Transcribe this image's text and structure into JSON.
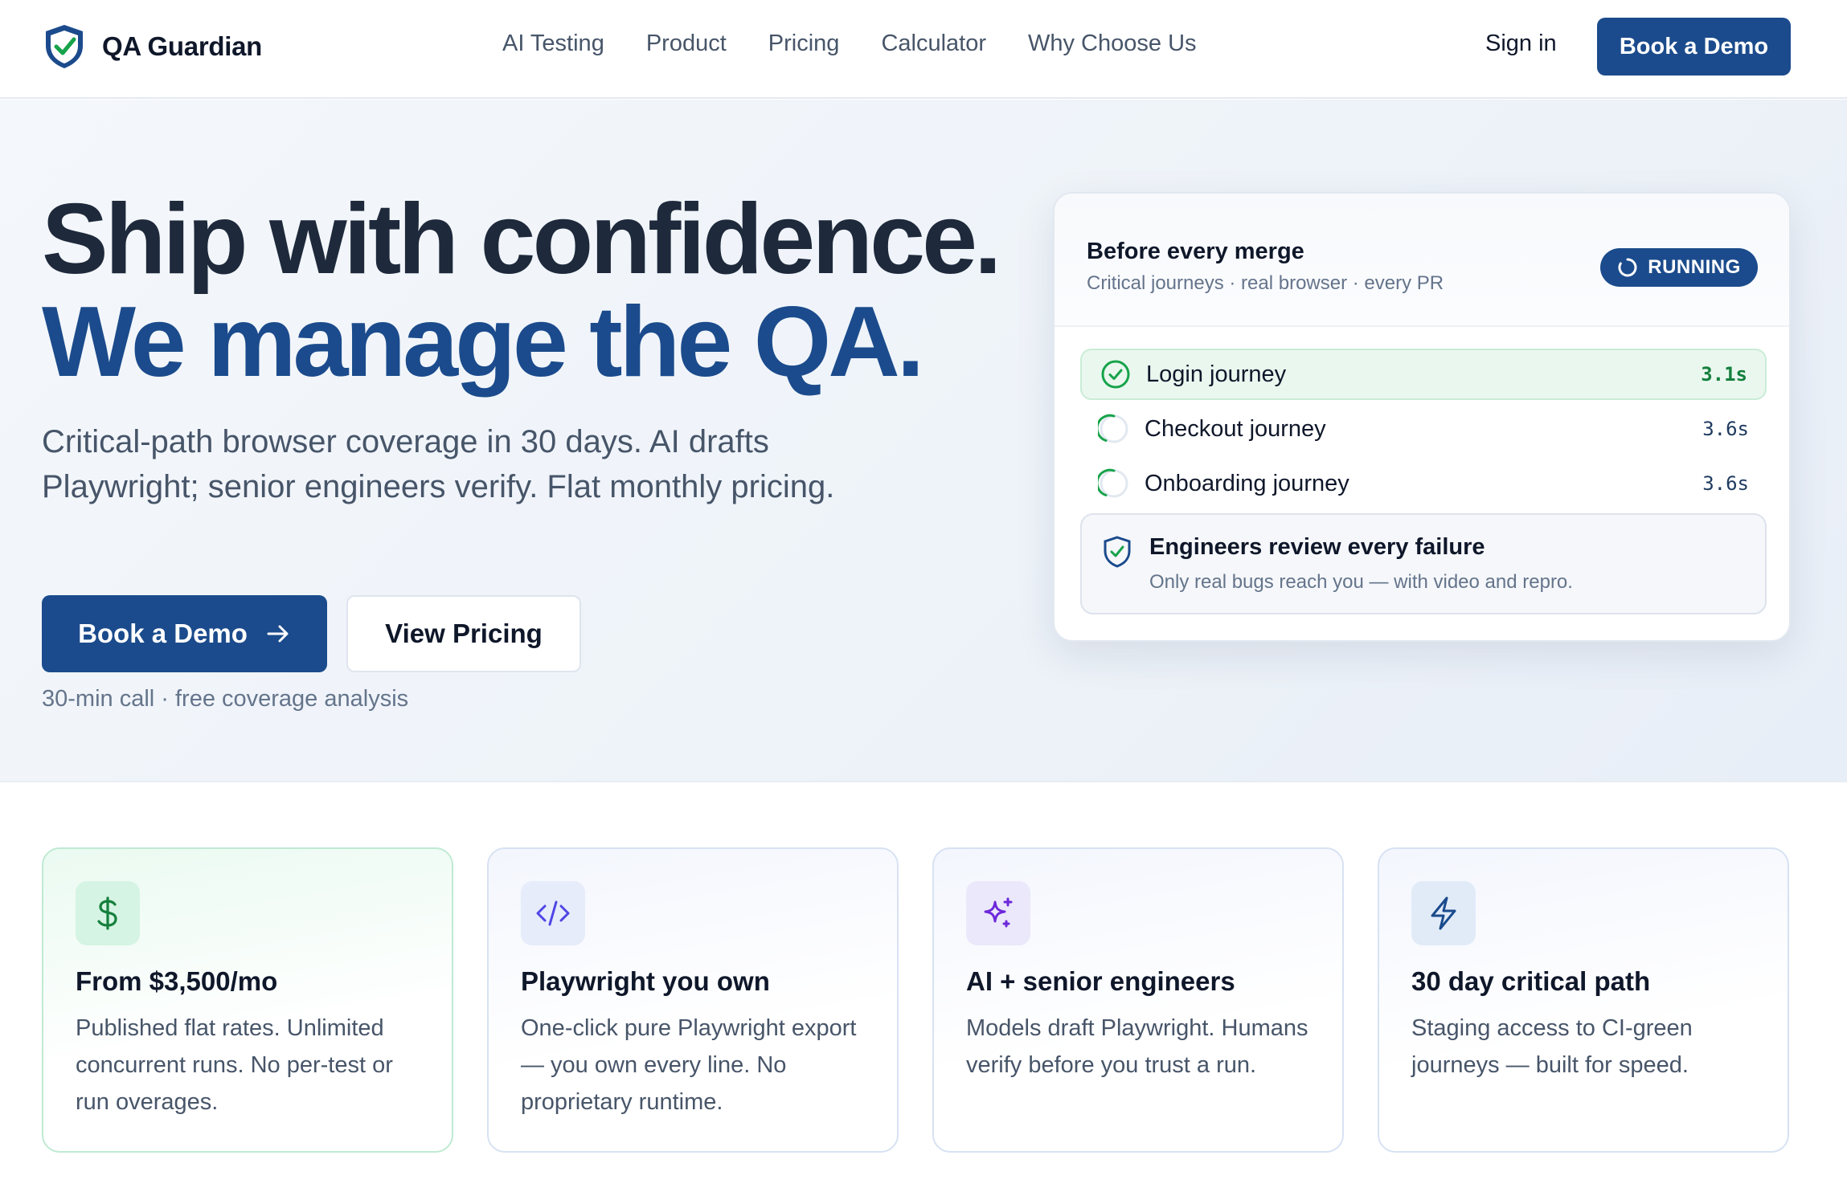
{
  "nav": {
    "brand": "QA Guardian",
    "links": [
      "AI Testing",
      "Product",
      "Pricing",
      "Calculator",
      "Why Choose Us"
    ],
    "sign_in": "Sign in",
    "cta": "Book a Demo"
  },
  "hero": {
    "headline_line1": "Ship with confidence.",
    "headline_line2": "We manage the QA.",
    "subtitle": "Critical-path browser coverage in 30 days. AI drafts Playwright; senior engineers verify. Flat monthly pricing.",
    "primary_cta": "Book a Demo",
    "secondary_cta": "View Pricing",
    "note": "30-min call · free coverage analysis"
  },
  "run_card": {
    "title": "Before every merge",
    "subtitle": "Critical journeys · real browser · every PR",
    "status": "RUNNING",
    "jobs": [
      {
        "label": "Login journey",
        "time": "3.1s",
        "state": "done"
      },
      {
        "label": "Checkout journey",
        "time": "3.6s",
        "state": "running"
      },
      {
        "label": "Onboarding journey",
        "time": "3.6s",
        "state": "running"
      }
    ],
    "review_title": "Engineers review every failure",
    "review_subtitle": "Only real bugs reach you — with video and repro."
  },
  "features": [
    {
      "icon": "dollar-icon",
      "title": "From $3,500/mo",
      "desc": "Published flat rates. Unlimited concurrent runs. No per-test or run overages."
    },
    {
      "icon": "code-icon",
      "title": "Playwright you own",
      "desc": "One-click pure Playwright export — you own every line. No proprietary runtime."
    },
    {
      "icon": "sparkles-icon",
      "title": "AI + senior engineers",
      "desc": "Models draft Playwright. Humans verify before you trust a run."
    },
    {
      "icon": "lightning-icon",
      "title": "30 day critical path",
      "desc": "Staging access to CI-green journeys — built for speed."
    }
  ],
  "colors": {
    "brand": "#1b4b8c",
    "success": "#16a34a",
    "text": "#0f172a",
    "muted": "#64748b"
  }
}
